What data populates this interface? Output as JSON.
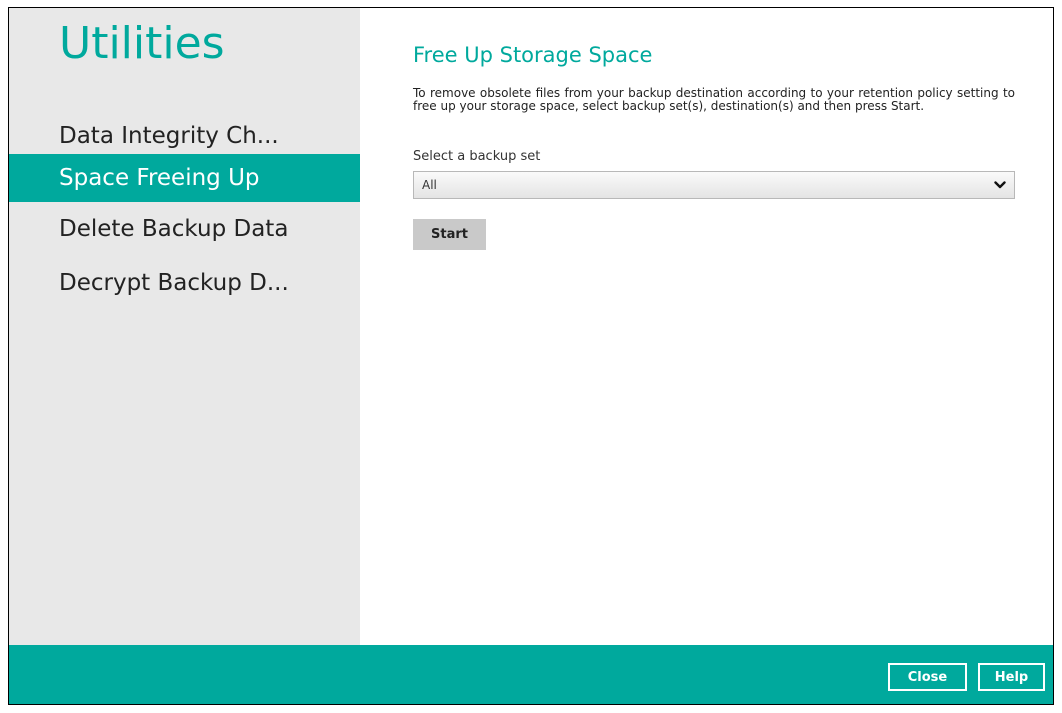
{
  "sidebar": {
    "title": "Utilities",
    "items": [
      {
        "label": "Data Integrity Ch...",
        "active": false
      },
      {
        "label": "Space Freeing Up",
        "active": true
      },
      {
        "label": "Delete Backup Data",
        "active": false
      },
      {
        "label": "Decrypt Backup D...",
        "active": false
      }
    ]
  },
  "main": {
    "title": "Free Up Storage Space",
    "description": "To remove obsolete files from your backup destination according to your retention policy setting to free up your storage space, select backup set(s), destination(s) and then press Start.",
    "backup_set_label": "Select a backup set",
    "backup_set_value": "All",
    "start_label": "Start"
  },
  "footer": {
    "close_label": "Close",
    "help_label": "Help"
  },
  "colors": {
    "accent": "#00a99d",
    "sidebar_bg": "#e8e8e8",
    "button_gray": "#c9c9c9"
  },
  "icons": {
    "dropdown": "chevron-down-icon"
  }
}
